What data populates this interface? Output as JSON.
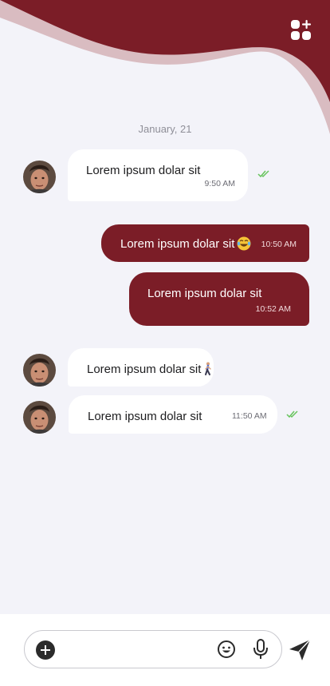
{
  "theme": {
    "accent": "#7b1d27",
    "accent_light": "#d9bcc1",
    "background": "#f3f3f9",
    "incoming_bubble": "#ffffff",
    "read_receipt": "#66c35c"
  },
  "header": {
    "apps_icon": "apps-add-icon"
  },
  "chat": {
    "date": "January, 21",
    "messages": [
      {
        "direction": "incoming",
        "text": "Lorem ipsum dolar sit",
        "time": "9:50 AM",
        "read": true
      },
      {
        "direction": "outgoing",
        "text": "Lorem ipsum dolar sit",
        "emoji": "😂",
        "time": "10:50 AM"
      },
      {
        "direction": "outgoing",
        "text": "Lorem ipsum dolar sit",
        "time": "10:52 AM"
      },
      {
        "direction": "incoming",
        "text": "Lorem ipsum dolar sit",
        "emoji": "🚶"
      },
      {
        "direction": "incoming",
        "text": "Lorem ipsum dolar sit",
        "time": "11:50 AM",
        "read": true
      }
    ]
  },
  "composer": {
    "placeholder": "",
    "icons": [
      "plus-icon",
      "emoji-icon",
      "microphone-icon",
      "send-icon"
    ]
  }
}
